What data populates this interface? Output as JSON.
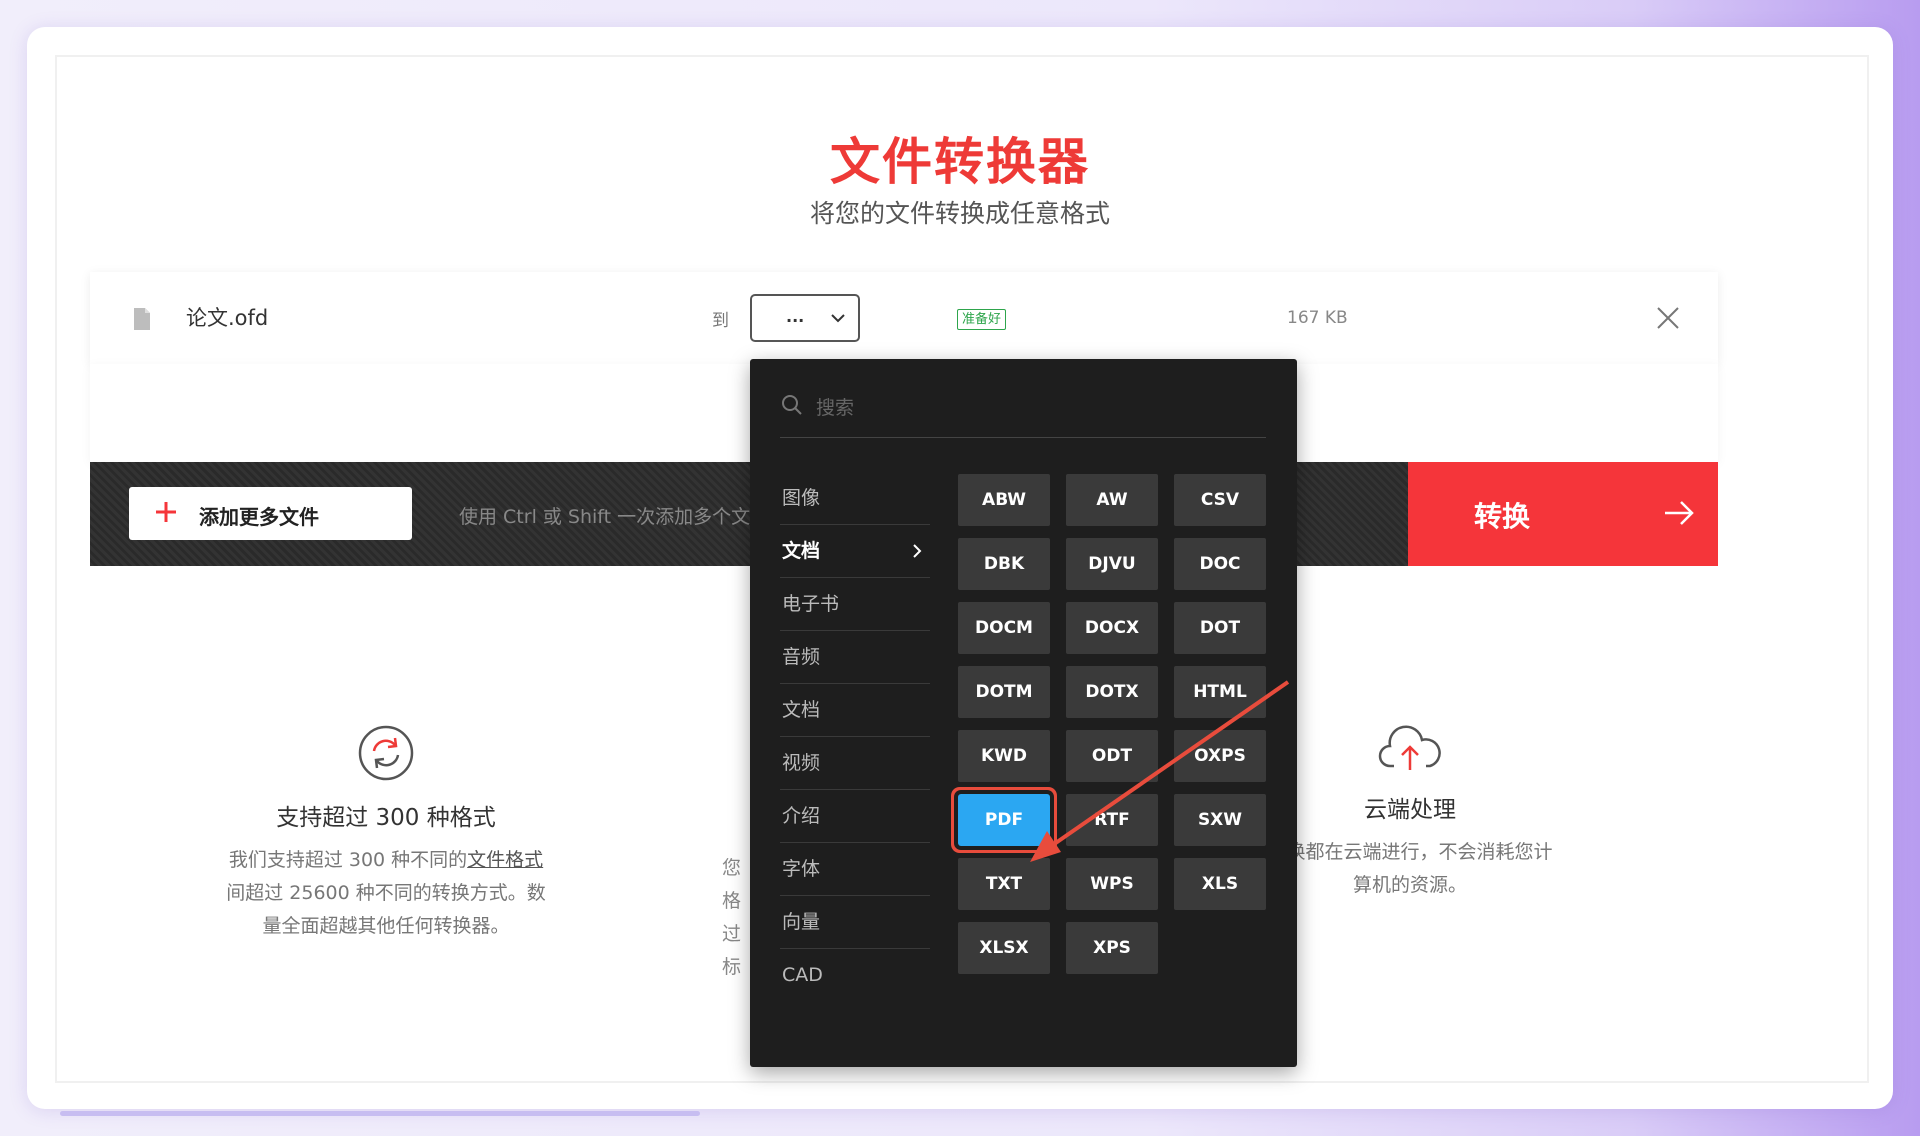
{
  "hero": {
    "title": "文件转换器",
    "subtitle": "将您的文件转换成任意格式"
  },
  "file": {
    "name": "论文.ofd",
    "to_label": "到",
    "selected_format": "...",
    "status": "准备好",
    "size": "167 KB"
  },
  "toolbar": {
    "add_more_label": "添加更多文件",
    "hint": "使用 Ctrl 或 Shift 一次添加多个文件",
    "convert_label": "转换"
  },
  "features": {
    "left": {
      "title": "支持超过 300 种格式",
      "desc_1": "我们支持超过 300 种不同的",
      "desc_link": "文件格式",
      "desc_2": "间超过 25600 种不同的转换方式。数",
      "desc_3": "量全面超越其他任何转换器。"
    },
    "mid_partial": [
      "您",
      "格",
      "过",
      "标"
    ],
    "right": {
      "title": "云端处理",
      "desc_1": "转换都在云端进行，不会消耗您计",
      "desc_2": "算机的资源。"
    }
  },
  "dropdown": {
    "search_placeholder": "搜索",
    "categories": [
      "图像",
      "文档",
      "电子书",
      "音频",
      "文档",
      "视频",
      "介绍",
      "字体",
      "向量",
      "CAD"
    ],
    "active_category_index": 1,
    "formats": [
      "ABW",
      "AW",
      "CSV",
      "DBK",
      "DJVU",
      "DOC",
      "DOCM",
      "DOCX",
      "DOT",
      "DOTM",
      "DOTX",
      "HTML",
      "KWD",
      "ODT",
      "OXPS",
      "PDF",
      "RTF",
      "SXW",
      "TXT",
      "WPS",
      "XLS",
      "XLSX",
      "XPS"
    ],
    "selected_format": "PDF"
  },
  "colors": {
    "brand_red": "#ee3a37",
    "convert_red": "#f5353a",
    "selected_blue": "#2ba7f2",
    "annotation_red": "#e84c3c",
    "status_green": "#2ea54c"
  }
}
